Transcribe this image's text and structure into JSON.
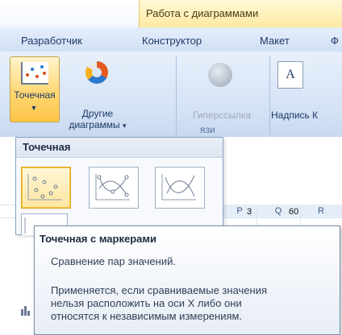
{
  "context_tab": "Работа с диаграммами",
  "tabs": [
    "Разработчик",
    "Конструктор",
    "Макет",
    "Ф"
  ],
  "ribbon": {
    "scatter_button": "Точечная",
    "other_charts_line1": "Другие",
    "other_charts_line2": "диаграммы",
    "hyperlink_button": "Гиперссылка",
    "caption_button": "Надпись",
    "caption_icon_letter": "A",
    "group_connections": "язи",
    "truncated_next": "К"
  },
  "dropdown": {
    "title": "Точечная"
  },
  "sheet": {
    "columns": [
      "P",
      "Q",
      "R"
    ],
    "cells": [
      "3",
      "60"
    ]
  },
  "tooltip": {
    "title": "Точечная с маркерами",
    "description": "Сравнение пар значений.",
    "body": "Применяется, если сравниваемые значения\nнельзя расположить на оси X либо они\nотносятся к независимым измерениям."
  }
}
